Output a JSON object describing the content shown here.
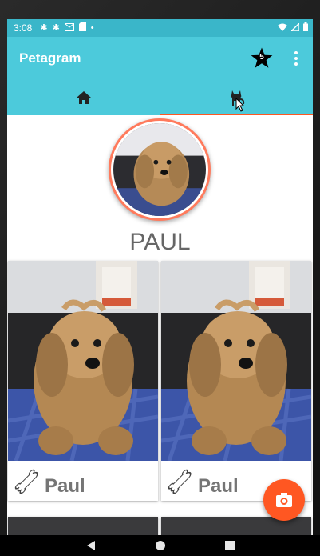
{
  "status_bar": {
    "time": "3:08",
    "icons": [
      "gear-icon",
      "gear-icon",
      "gmail-icon",
      "sd-card-icon",
      "dot-icon"
    ],
    "right_icons": [
      "wifi-icon",
      "signal-icon",
      "battery-icon"
    ]
  },
  "app_bar": {
    "title": "Petagram",
    "favorites_count": "5",
    "favorites_icon": "star-icon",
    "menu_icon": "more-vert-icon"
  },
  "tabs": [
    {
      "icon": "home-icon",
      "selected": false
    },
    {
      "icon": "cat-icon",
      "selected": true
    }
  ],
  "profile": {
    "name": "PAUL"
  },
  "pets": [
    {
      "name": "Paul",
      "icon": "bone-icon"
    },
    {
      "name": "Paul",
      "icon": "bone-icon"
    },
    {
      "name": "",
      "icon": ""
    },
    {
      "name": "",
      "icon": ""
    }
  ],
  "fab": {
    "icon": "camera-icon"
  },
  "nav_bar": {
    "icons": [
      "back-icon",
      "home-circle-icon",
      "recents-icon"
    ]
  },
  "colors": {
    "status_bar": "#3ab6c9",
    "primary": "#4ccadb",
    "accent": "#ff5722"
  }
}
